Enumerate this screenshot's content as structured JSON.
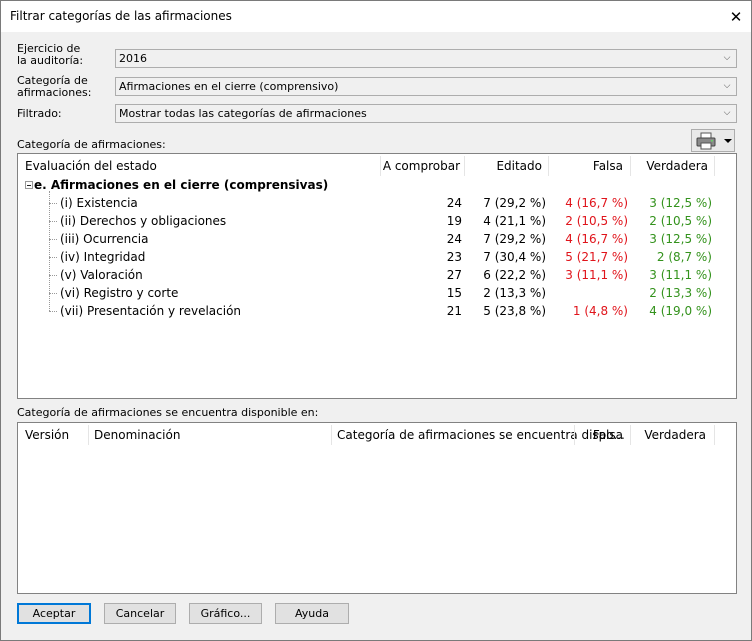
{
  "window": {
    "title": "Filtrar categorías de las afirmaciones",
    "close_glyph": "✕"
  },
  "filters": {
    "ejercicio": {
      "label_line1": "Ejercicio de",
      "label_line2": "la auditoría:",
      "value": "2016"
    },
    "categoria": {
      "label_line1": "Categoría de",
      "label_line2": "afirmaciones:",
      "value": "Afirmaciones en el cierre (comprensivo)"
    },
    "filtrado": {
      "label": "Filtrado:",
      "value": "Mostrar todas las categorías de afirmaciones"
    }
  },
  "upper": {
    "section_label": "Categoría de afirmaciones:",
    "print_icon": "printer-icon",
    "columns": {
      "name": "Evaluación del estado",
      "to_check": "A comprobar",
      "edited": "Editado",
      "false": "Falsa",
      "true": "Verdadera"
    },
    "group": {
      "label": "e. Afirmaciones en el cierre (comprensivas)"
    },
    "rows": [
      {
        "name": "(i) Existencia",
        "to_check": "24",
        "edited": "7 (29,2 %)",
        "false": "4 (16,7 %)",
        "true": "3 (12,5 %)"
      },
      {
        "name": "(ii) Derechos y obligaciones",
        "to_check": "19",
        "edited": "4 (21,1 %)",
        "false": "2 (10,5 %)",
        "true": "2 (10,5 %)"
      },
      {
        "name": "(iii) Ocurrencia",
        "to_check": "24",
        "edited": "7 (29,2 %)",
        "false": "4 (16,7 %)",
        "true": "3 (12,5 %)"
      },
      {
        "name": "(iv) Integridad",
        "to_check": "23",
        "edited": "7 (30,4 %)",
        "false": "5 (21,7 %)",
        "true": "2 (8,7 %)"
      },
      {
        "name": "(v) Valoración",
        "to_check": "27",
        "edited": "6 (22,2 %)",
        "false": "3 (11,1 %)",
        "true": "3 (11,1 %)"
      },
      {
        "name": "(vi) Registro y corte",
        "to_check": "15",
        "edited": "2 (13,3 %)",
        "false": "",
        "true": "2 (13,3 %)"
      },
      {
        "name": "(vii) Presentación y revelación",
        "to_check": "21",
        "edited": "5 (23,8 %)",
        "false": "1 (4,8 %)",
        "true": "4 (19,0 %)"
      }
    ]
  },
  "lower": {
    "section_label": "Categoría de afirmaciones se encuentra disponible en:",
    "columns": {
      "version": "Versión",
      "name": "Denominación",
      "category": "Categoría de afirmaciones se encuentra dispo...",
      "false": "Falsa",
      "true": "Verdadera"
    }
  },
  "buttons": {
    "accept": "Aceptar",
    "cancel": "Cancelar",
    "chart": "Gráfico...",
    "help": "Ayuda"
  },
  "colors": {
    "false_value": "#e0141b",
    "true_value": "#33921c",
    "focus": "#0078d7"
  }
}
